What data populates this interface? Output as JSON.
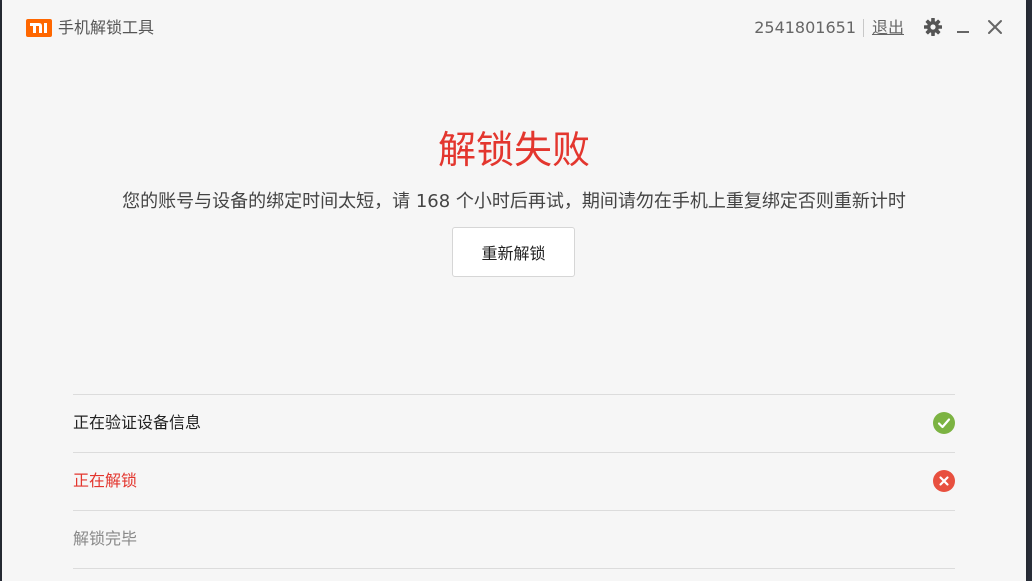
{
  "app": {
    "title": "手机解锁工具",
    "account_id": "2541801651",
    "logout_label": "退出"
  },
  "result": {
    "title": "解锁失败",
    "message": "您的账号与设备的绑定时间太短，请 168 个小时后再试，期间请勿在手机上重复绑定否则重新计时",
    "retry_label": "重新解锁"
  },
  "steps": [
    {
      "label": "正在验证设备信息",
      "status": "done"
    },
    {
      "label": "正在解锁",
      "status": "failed"
    },
    {
      "label": "解锁完毕",
      "status": "pending"
    }
  ],
  "colors": {
    "brand": "#ff6700",
    "error": "#e3362e",
    "success": "#7cb342"
  },
  "icons": [
    "mi-logo-icon",
    "gear-icon",
    "minimize-icon",
    "close-icon",
    "check-circle-icon",
    "error-circle-icon"
  ]
}
